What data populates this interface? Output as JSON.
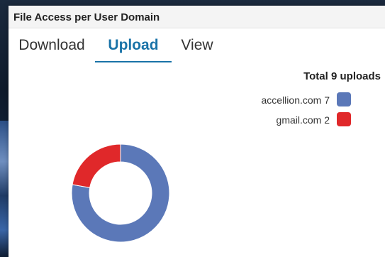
{
  "panel": {
    "title": "File Access per User Domain"
  },
  "tabs": [
    {
      "label": "Download",
      "active": false
    },
    {
      "label": "Upload",
      "active": true
    },
    {
      "label": "View",
      "active": false
    }
  ],
  "summary": {
    "title": "Total 9 uploads"
  },
  "legend": [
    {
      "label": "accellion.com 7",
      "color": "#5b78b8"
    },
    {
      "label": "gmail.com 2",
      "color": "#e0282a"
    }
  ],
  "chart_data": {
    "type": "pie",
    "variant": "donut",
    "title": "Total 9 uploads",
    "categories": [
      "accellion.com",
      "gmail.com"
    ],
    "values": [
      7,
      2
    ],
    "colors": [
      "#5b78b8",
      "#e0282a"
    ],
    "legend_position": "top-right"
  }
}
